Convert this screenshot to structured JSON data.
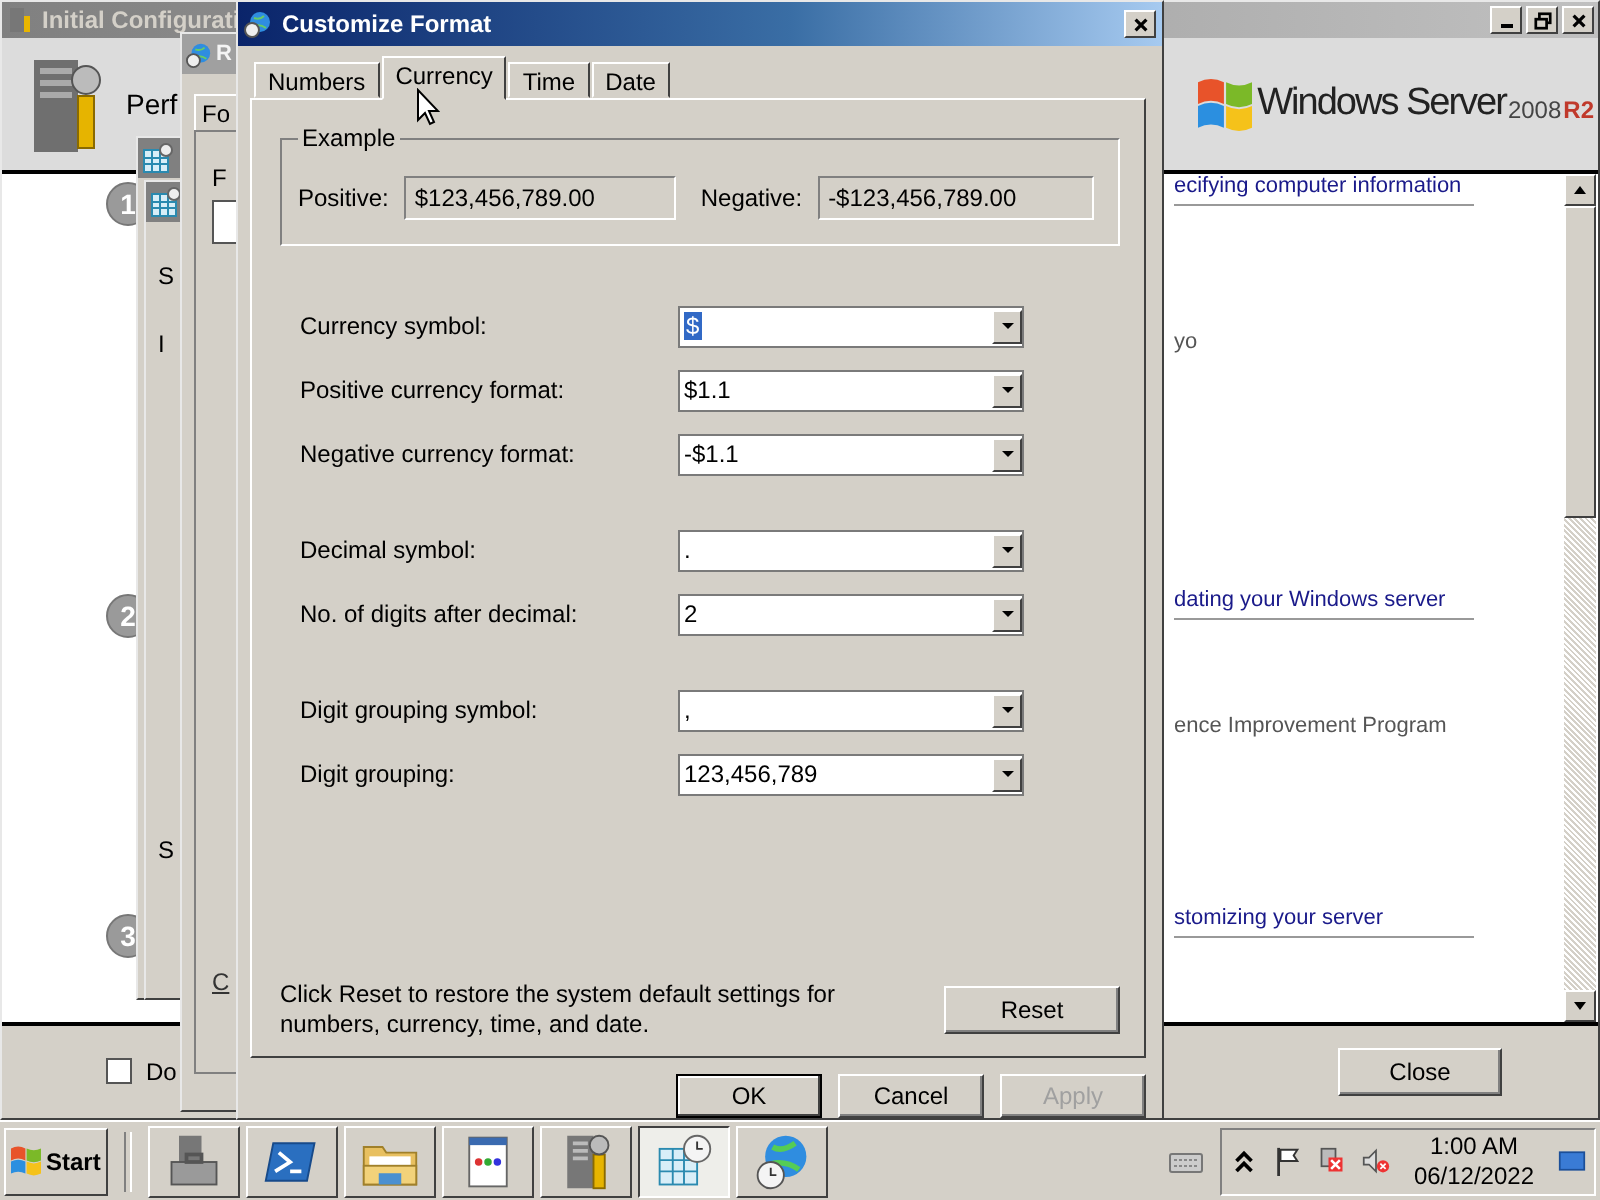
{
  "background_window": {
    "title": "Initial Configurati",
    "heading": "Perf",
    "logo": {
      "name": "Windows Server",
      "version": "2008",
      "edition": "R2"
    },
    "steps": [
      {
        "number": "1",
        "heading": "ecifying computer information",
        "note": "yo"
      },
      {
        "number": "2",
        "heading": "dating your Windows server",
        "note": "ence Improvement Program"
      },
      {
        "number": "3",
        "heading": "stomizing your server"
      }
    ],
    "footer_checkbox": {
      "label": "Do",
      "checked": false
    },
    "close_button": "Close"
  },
  "side_window": {
    "lines": [
      "S",
      "I",
      "S"
    ]
  },
  "region_window": {
    "title": "R",
    "tab": "Fo",
    "label": "F",
    "link": "C"
  },
  "dialog": {
    "title": "Customize Format",
    "tabs": [
      {
        "label": "Numbers",
        "selected": false
      },
      {
        "label": "Currency",
        "selected": true
      },
      {
        "label": "Time",
        "selected": false
      },
      {
        "label": "Date",
        "selected": false
      }
    ],
    "example": {
      "title": "Example",
      "positive_label": "Positive:",
      "positive": "$123,456,789.00",
      "negative_label": "Negative:",
      "negative": "-$123,456,789.00"
    },
    "groups": [
      {
        "fields": [
          {
            "label": "Currency symbol:",
            "value": "$",
            "focused": true
          },
          {
            "label": "Positive currency format:",
            "value": "$1.1",
            "focused": false
          },
          {
            "label": "Negative currency format:",
            "value": "-$1.1",
            "focused": false
          }
        ]
      },
      {
        "fields": [
          {
            "label": "Decimal symbol:",
            "value": ".",
            "focused": false
          },
          {
            "label": "No. of digits after decimal:",
            "value": "2",
            "focused": false
          }
        ]
      },
      {
        "fields": [
          {
            "label": "Digit grouping symbol:",
            "value": ",",
            "focused": false
          },
          {
            "label": "Digit grouping:",
            "value": "123,456,789",
            "focused": false
          }
        ]
      }
    ],
    "reset_note": "Click Reset to restore the system default settings for numbers, currency, time, and date.",
    "reset_button": "Reset",
    "buttons": [
      {
        "label": "OK",
        "default": true,
        "disabled": false
      },
      {
        "label": "Cancel",
        "default": false,
        "disabled": false
      },
      {
        "label": "Apply",
        "default": false,
        "disabled": true
      }
    ]
  },
  "taskbar": {
    "start": "Start",
    "apps": [
      {
        "kind": "toolbox",
        "active": false
      },
      {
        "kind": "terminal",
        "active": false
      },
      {
        "kind": "folder",
        "active": false
      },
      {
        "kind": "document",
        "active": false
      },
      {
        "kind": "server",
        "active": false
      },
      {
        "kind": "calendar",
        "active": true
      },
      {
        "kind": "globe",
        "active": false
      }
    ],
    "clock": {
      "time": "1:00 AM",
      "date": "06/12/2022"
    }
  }
}
